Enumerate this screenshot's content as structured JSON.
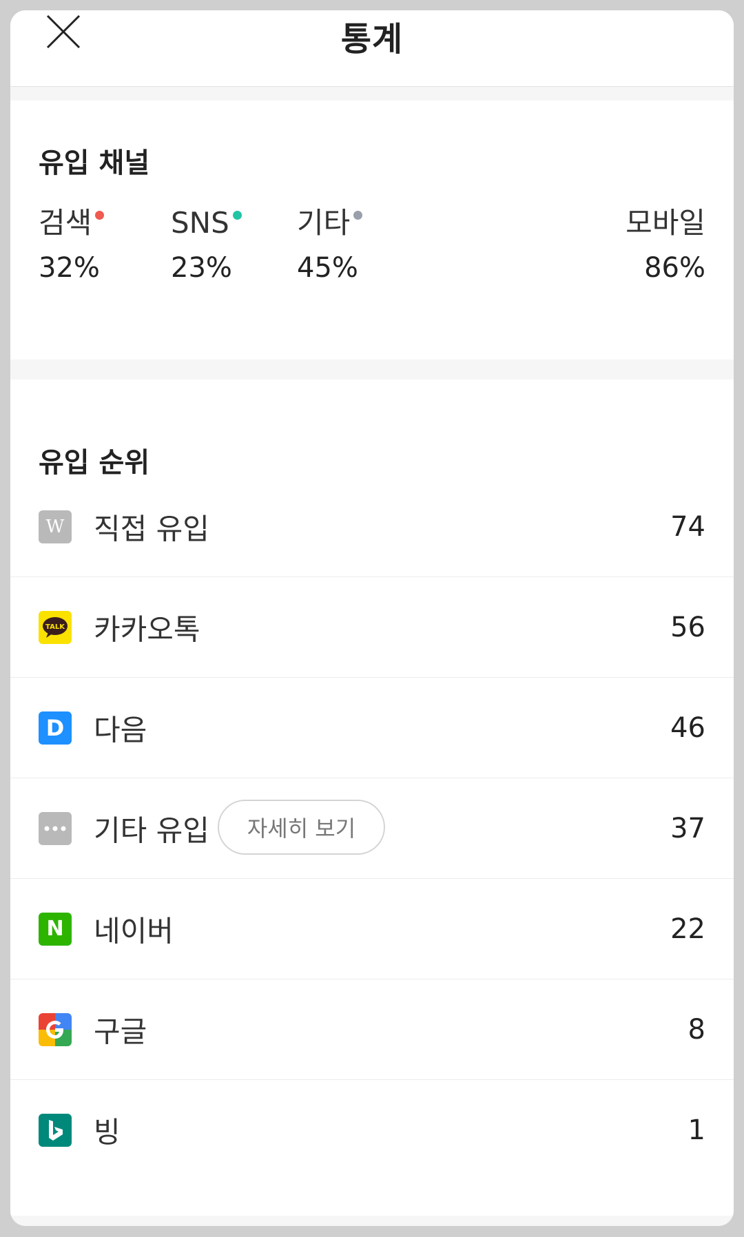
{
  "header": {
    "title": "통계"
  },
  "channels": {
    "title": "유입 채널",
    "items": [
      {
        "label": "검색",
        "value": "32%",
        "dot_color": "#f05a4f"
      },
      {
        "label": "SNS",
        "value": "23%",
        "dot_color": "#21c5a6"
      },
      {
        "label": "기타",
        "value": "45%",
        "dot_color": "#9aa0ab"
      }
    ],
    "mobile": {
      "label": "모바일",
      "value": "86%"
    }
  },
  "ranking": {
    "title": "유입 순위",
    "detail_button": "자세히 보기",
    "items": [
      {
        "label": "직접 유입",
        "count": "74",
        "icon": "w-icon"
      },
      {
        "label": "카카오톡",
        "count": "56",
        "icon": "kakaotalk-icon"
      },
      {
        "label": "다음",
        "count": "46",
        "icon": "daum-icon"
      },
      {
        "label": "기타 유입",
        "count": "37",
        "icon": "more-icon"
      },
      {
        "label": "네이버",
        "count": "22",
        "icon": "naver-icon"
      },
      {
        "label": "구글",
        "count": "8",
        "icon": "google-icon"
      },
      {
        "label": "빙",
        "count": "1",
        "icon": "bing-icon"
      }
    ],
    "icon_text": {
      "w": "W",
      "kakao": "TALK",
      "daum": "D",
      "naver": "N"
    }
  },
  "colors": {
    "kakao": "#fae100",
    "daum": "#1e90ff",
    "naver": "#2db400",
    "bing": "#00897b",
    "gray_icon": "#b9b9b9"
  }
}
